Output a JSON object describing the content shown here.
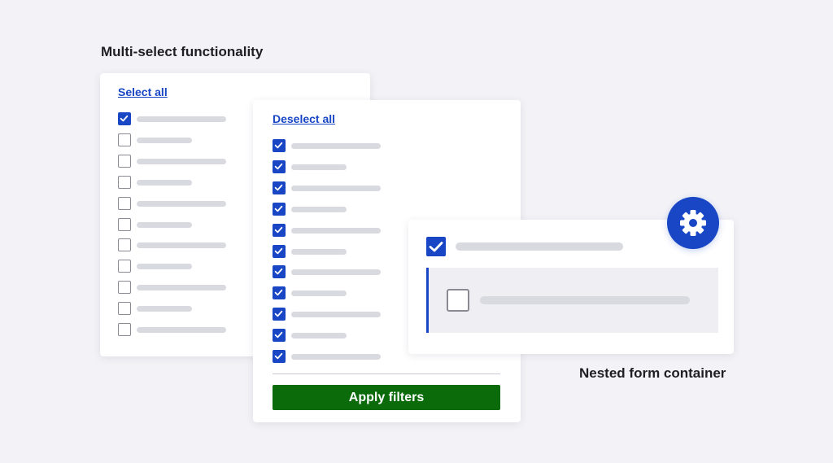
{
  "captions": {
    "multi_select": "Multi-select functionality",
    "nested": "Nested form container"
  },
  "panel_left": {
    "link_label": "Select all",
    "items": [
      {
        "checked": true,
        "bar": "long"
      },
      {
        "checked": false,
        "bar": "short"
      },
      {
        "checked": false,
        "bar": "long"
      },
      {
        "checked": false,
        "bar": "short"
      },
      {
        "checked": false,
        "bar": "long"
      },
      {
        "checked": false,
        "bar": "short"
      },
      {
        "checked": false,
        "bar": "long"
      },
      {
        "checked": false,
        "bar": "short"
      },
      {
        "checked": false,
        "bar": "long"
      },
      {
        "checked": false,
        "bar": "short"
      },
      {
        "checked": false,
        "bar": "long"
      }
    ]
  },
  "panel_middle": {
    "link_label": "Deselect all",
    "button_label": "Apply filters",
    "items": [
      {
        "checked": true,
        "bar": "long"
      },
      {
        "checked": true,
        "bar": "short"
      },
      {
        "checked": true,
        "bar": "long"
      },
      {
        "checked": true,
        "bar": "short"
      },
      {
        "checked": true,
        "bar": "long"
      },
      {
        "checked": true,
        "bar": "short"
      },
      {
        "checked": true,
        "bar": "long"
      },
      {
        "checked": true,
        "bar": "short"
      },
      {
        "checked": true,
        "bar": "long"
      },
      {
        "checked": true,
        "bar": "short"
      },
      {
        "checked": true,
        "bar": "long"
      }
    ]
  },
  "panel_nested": {
    "parent_checked": true,
    "child_checked": false,
    "icon": "gear-icon"
  },
  "colors": {
    "accent": "#1846c4",
    "button": "#0b6b0b",
    "background": "#f3f3f7",
    "placeholder_bar": "#d9d9e0"
  }
}
